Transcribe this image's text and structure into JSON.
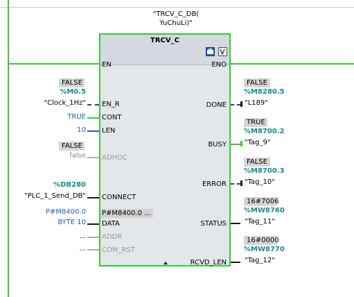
{
  "instance": {
    "line1": "\"TRCV_C_DB(",
    "line2": "YuChuLi)\""
  },
  "block": {
    "title": "TRCV_C",
    "inputs": {
      "en": "EN",
      "en_r": "EN_R",
      "cont": "CONT",
      "len": "LEN",
      "adhoc": "ADHOC",
      "connect": "CONNECT",
      "data": "DATA",
      "addr": "ADDR",
      "com_rst": "COM_RST"
    },
    "outputs": {
      "eno": "ENO",
      "done": "DONE",
      "busy": "BUSY",
      "error": "ERROR",
      "status": "STATUS",
      "rcvd_len": "RCVD_LEN"
    },
    "data_ptr": "P#M8400.0 ...",
    "icons": [
      "block-view-icon",
      "variable-icon"
    ],
    "expand_icon": "triangle-up-icon"
  },
  "params": {
    "en_r": {
      "monitor": "FALSE",
      "address": "%M0.5",
      "tag": "\"Clock_1Hz\""
    },
    "cont": {
      "value": "TRUE"
    },
    "len": {
      "value": "10"
    },
    "adhoc": {
      "monitor": "FALSE",
      "value": "false"
    },
    "connect": {
      "address": "%DB280",
      "tag": "\"PLC_1_Send_DB\""
    },
    "data": {
      "line1": "P#M8400.0",
      "line2": "BYTE 10"
    },
    "addr": {
      "value": "..."
    },
    "com_rst": {
      "value": "..."
    },
    "done": {
      "monitor": "FALSE",
      "address": "%M8280.5",
      "tag": "\"L189\""
    },
    "busy": {
      "monitor": "TRUE",
      "address": "%M8700.2",
      "tag": "\"Tag_9\""
    },
    "error": {
      "monitor": "FALSE",
      "address": "%M8700.3",
      "tag": "\"Tag_10\""
    },
    "status": {
      "monitor": "16#7006",
      "address": "%MW8760",
      "tag": "\"Tag_11\""
    },
    "rcvd_len": {
      "monitor": "16#0000",
      "address": "%MW8770",
      "tag": "\"Tag_12\""
    }
  },
  "colors": {
    "powerflow": "#33cc33",
    "address": "#1a8a8a",
    "constant": "#2b57c9",
    "monitor_bg": "#d6d6d6",
    "block_bg": "#e3e6ea"
  }
}
